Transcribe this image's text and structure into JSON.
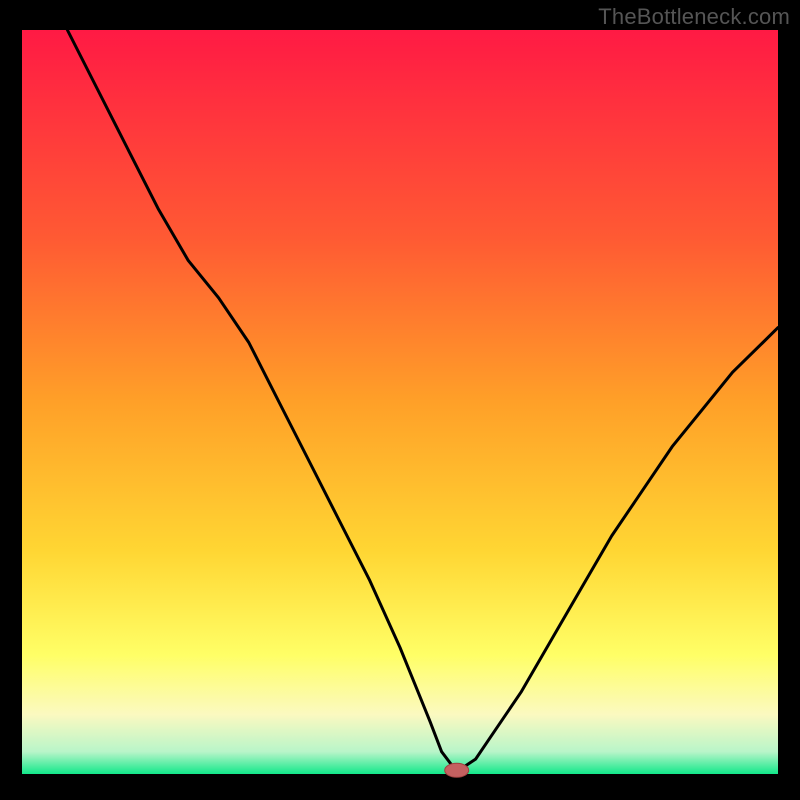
{
  "watermark": "TheBottleneck.com",
  "chart_data": {
    "type": "line",
    "title": "",
    "xlabel": "",
    "ylabel": "",
    "xlim": [
      0,
      100
    ],
    "ylim": [
      0,
      100
    ],
    "grid": false,
    "legend": false,
    "background_gradient": [
      "#ff1a44",
      "#ff8a2a",
      "#ffd633",
      "#ffff66",
      "#fff9b0",
      "#26f07f"
    ],
    "series": [
      {
        "name": "bottleneck-curve",
        "x": [
          6,
          10,
          14,
          18,
          22,
          26,
          30,
          34,
          38,
          42,
          46,
          50,
          52,
          54,
          55.5,
          57,
          58.5,
          60,
          62,
          66,
          70,
          74,
          78,
          82,
          86,
          90,
          94,
          98,
          100
        ],
        "y": [
          100,
          92,
          84,
          76,
          69,
          64,
          58,
          50,
          42,
          34,
          26,
          17,
          12,
          7,
          3,
          1,
          1,
          2,
          5,
          11,
          18,
          25,
          32,
          38,
          44,
          49,
          54,
          58,
          60
        ]
      }
    ],
    "marker": {
      "x": 57.5,
      "y": 0.5,
      "color": "#c46060",
      "rx": 12,
      "ry": 7
    }
  }
}
